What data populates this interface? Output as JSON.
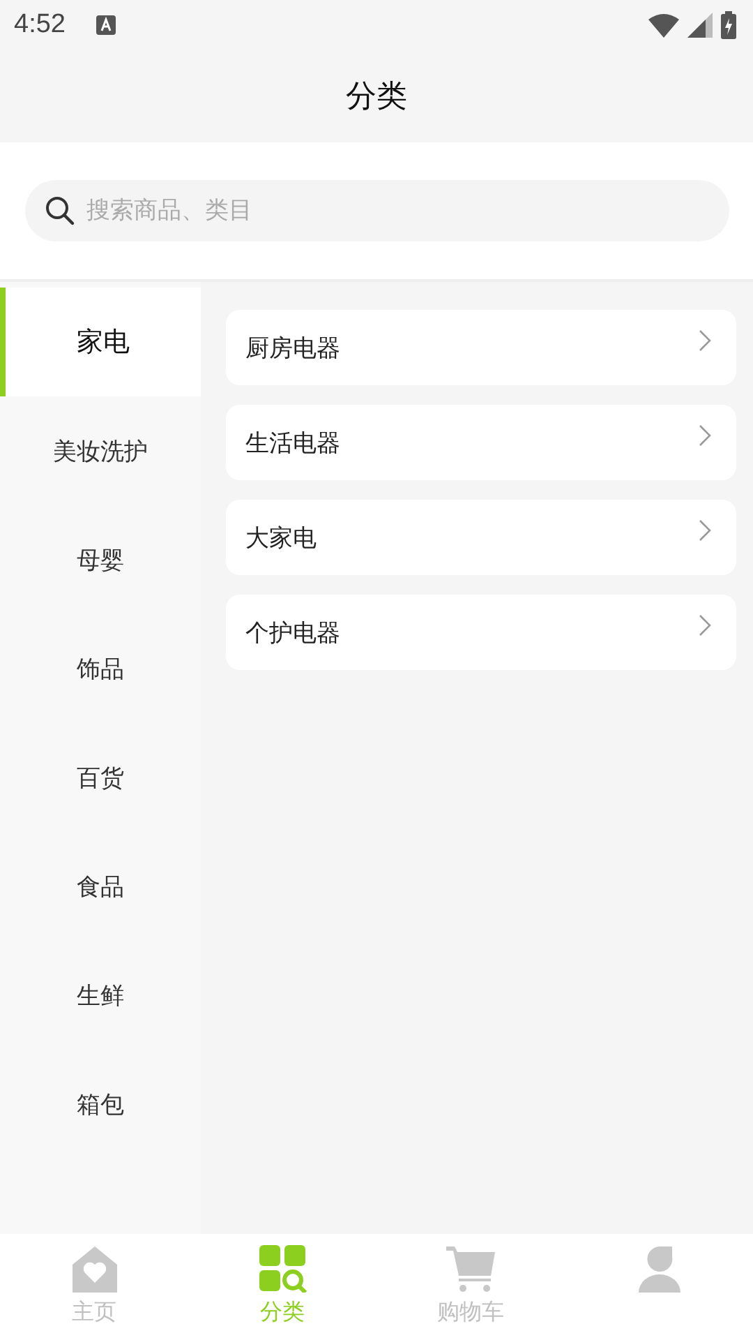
{
  "status_bar": {
    "time": "4:52"
  },
  "header": {
    "title": "分类"
  },
  "search": {
    "placeholder": "搜索商品、类目"
  },
  "categories": [
    {
      "label": "家电",
      "selected": true
    },
    {
      "label": "美妆洗护",
      "selected": false
    },
    {
      "label": "母婴",
      "selected": false
    },
    {
      "label": "饰品",
      "selected": false
    },
    {
      "label": "百货",
      "selected": false
    },
    {
      "label": "食品",
      "selected": false
    },
    {
      "label": "生鲜",
      "selected": false
    },
    {
      "label": "箱包",
      "selected": false
    }
  ],
  "subcategories": [
    "厨房电器",
    "生活电器",
    "大家电",
    "个护电器"
  ],
  "tab_bar": [
    {
      "kind": "home",
      "label": "主页",
      "selected": false
    },
    {
      "kind": "category",
      "label": "分类",
      "selected": true
    },
    {
      "kind": "cart",
      "label": "购物车",
      "selected": false
    },
    {
      "kind": "profile",
      "selected": false
    }
  ]
}
